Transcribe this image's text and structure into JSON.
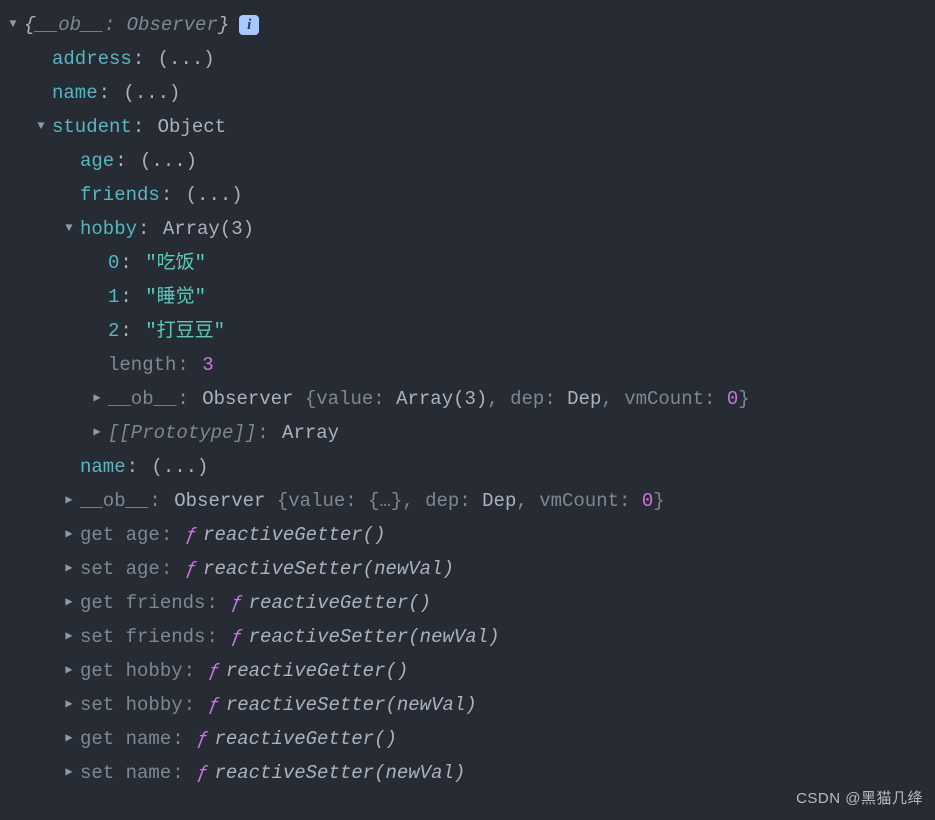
{
  "root": {
    "preview_open": "{",
    "preview_key": "__ob__",
    "preview_sep": ": ",
    "preview_val": "Observer",
    "preview_close": "}",
    "info": "i"
  },
  "level1": {
    "address": {
      "key": "address",
      "val": "(...)"
    },
    "name": {
      "key": "name",
      "val": "(...)"
    }
  },
  "student": {
    "key": "student",
    "val": "Object",
    "age": {
      "key": "age",
      "val": "(...)"
    },
    "friends": {
      "key": "friends",
      "val": "(...)"
    },
    "hobby": {
      "key": "hobby",
      "val": "Array(3)",
      "items": [
        {
          "idx": "0",
          "val": "\"吃饭\""
        },
        {
          "idx": "1",
          "val": "\"睡觉\""
        },
        {
          "idx": "2",
          "val": "\"打豆豆\""
        }
      ],
      "length": {
        "key": "length",
        "val": "3"
      },
      "ob": {
        "key": "__ob__",
        "type": "Observer ",
        "open": "{",
        "p1k": "value",
        "p1v": "Array(3)",
        "sep1": ", ",
        "p2k": "dep",
        "p2v": "Dep",
        "sep2": ", ",
        "p3k": "vmCount",
        "p3v": "0",
        "close": "}"
      },
      "proto": {
        "key": "[[Prototype]]",
        "val": "Array"
      }
    },
    "sname": {
      "key": "name",
      "val": "(...)"
    },
    "ob": {
      "key": "__ob__",
      "type": "Observer ",
      "open": "{",
      "p1k": "value",
      "p1v": "{…}",
      "sep1": ", ",
      "p2k": "dep",
      "p2v": "Dep",
      "sep2": ", ",
      "p3k": "vmCount",
      "p3v": "0",
      "close": "}"
    },
    "accessors": [
      {
        "prefix": "get ",
        "name": "age",
        "fn": "reactiveGetter()"
      },
      {
        "prefix": "set ",
        "name": "age",
        "fn": "reactiveSetter(newVal)"
      },
      {
        "prefix": "get ",
        "name": "friends",
        "fn": "reactiveGetter()"
      },
      {
        "prefix": "set ",
        "name": "friends",
        "fn": "reactiveSetter(newVal)"
      },
      {
        "prefix": "get ",
        "name": "hobby",
        "fn": "reactiveGetter()"
      },
      {
        "prefix": "set ",
        "name": "hobby",
        "fn": "reactiveSetter(newVal)"
      },
      {
        "prefix": "get ",
        "name": "name",
        "fn": "reactiveGetter()"
      },
      {
        "prefix": "set ",
        "name": "name",
        "fn": "reactiveSetter(newVal)"
      }
    ]
  },
  "fsymbol": "ƒ",
  "colon": ":",
  "watermark": "CSDN @黑猫几绛"
}
